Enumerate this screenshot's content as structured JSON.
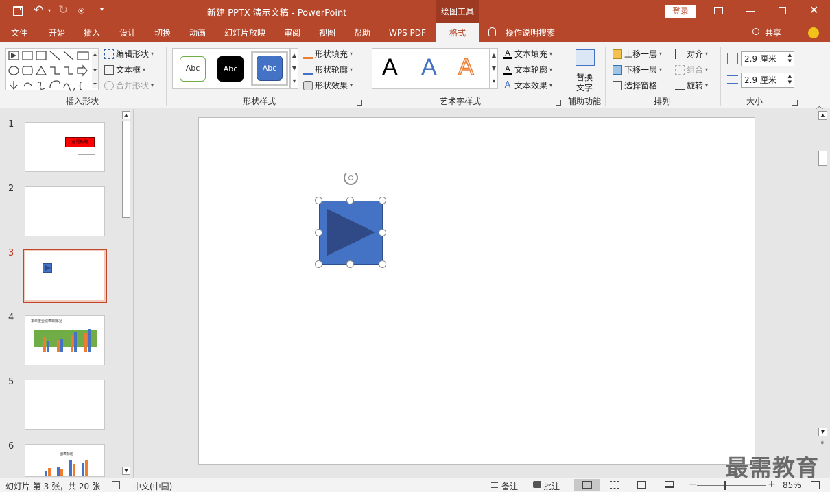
{
  "title": {
    "doc": "新建 PPTX 演示文稿",
    "sep": "-",
    "app": "PowerPoint",
    "context_tab": "绘图工具",
    "login": "登录"
  },
  "tabs": [
    "文件",
    "开始",
    "插入",
    "设计",
    "切换",
    "动画",
    "幻灯片放映",
    "审阅",
    "视图",
    "帮助",
    "WPS PDF",
    "格式",
    "操作说明搜索",
    "共享"
  ],
  "ribbon": {
    "insert_shapes": {
      "edit_shape": "编辑形状",
      "text_box": "文本框",
      "merge_shapes": "合并形状",
      "label": "插入形状"
    },
    "shape_styles": {
      "sample": "Abc",
      "fill": "形状填充",
      "outline": "形状轮廓",
      "effects": "形状效果",
      "label": "形状样式"
    },
    "wordart": {
      "sample": "A",
      "text_fill": "文本填充",
      "text_outline": "文本轮廓",
      "text_effects": "文本效果",
      "label": "艺术字样式"
    },
    "accessibility": {
      "alt_text_1": "替换",
      "alt_text_2": "文字",
      "label": "辅助功能"
    },
    "arrange": {
      "bring_forward": "上移一层",
      "send_backward": "下移一层",
      "selection_pane": "选择窗格",
      "align": "对齐",
      "group": "组合",
      "rotate": "旋转",
      "label": "排列"
    },
    "size": {
      "height": "2.9 厘米",
      "width": "2.9 厘米",
      "label": "大小"
    }
  },
  "slides": [
    "1",
    "2",
    "3",
    "4",
    "5",
    "6"
  ],
  "thumb_text": {
    "s1_title": "这是标题",
    "s4_title": "本年度业绩表现概况",
    "s6_title": "图表标题"
  },
  "status": {
    "slide_info": "幻灯片 第 3 张，共 20 张",
    "language": "中文(中国)",
    "notes": "备注",
    "comments": "批注",
    "zoom": "85%"
  },
  "watermark": "最需教育",
  "colors": {
    "accent": "#b7472a",
    "shape_fill": "#4472c4",
    "play_triangle": "#2f4a86"
  }
}
